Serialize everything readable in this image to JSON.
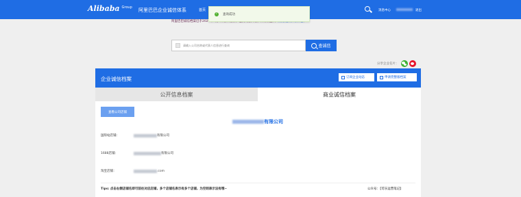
{
  "header": {
    "logo_mark": "Alibaba",
    "logo_group": "Group",
    "logo_cn": "阿里巴巴集团",
    "site_title": "阿里巴巴企业诚信体系",
    "nav_home": "首页",
    "message_center": "消息中心",
    "logout": "退出"
  },
  "toast": {
    "text": "查询成功",
    "icon": "check-icon"
  },
  "notice": {
    "text": "阿里巴巴诚信档案已于2020年1月9日发布更新，档案内容升级，详情请查阅",
    "link": "《诚信档案升级公告》"
  },
  "search": {
    "placeholder": "请输入公司名称或代表人信息进行查询",
    "button": "查诚信"
  },
  "share": {
    "label": "分享企业名片："
  },
  "panel": {
    "title": "企业诚信档案",
    "btn_follow": "订阅企业动态",
    "btn_report": "申请完整版档案",
    "tabs": [
      "公开信息档案",
      "商业诚信档案"
    ],
    "shop_button": "查看公司店铺",
    "company_suffix": "有限公司",
    "rows": [
      {
        "label": "国际站店铺：",
        "value": "有限公司"
      },
      {
        "label": "1688店铺：",
        "value": "有限公司"
      },
      {
        "label": "淘宝店铺：",
        "value": ".com"
      }
    ],
    "tips": "Tips: 点击右侧店铺名即可前往对应店铺，多个店铺名表示有多个店铺，为空则表示没有哦~",
    "wechat_account": "公众号：【可乐运营笔记】"
  },
  "colors": {
    "brand": "#1f6de4",
    "success": "#52b132"
  }
}
